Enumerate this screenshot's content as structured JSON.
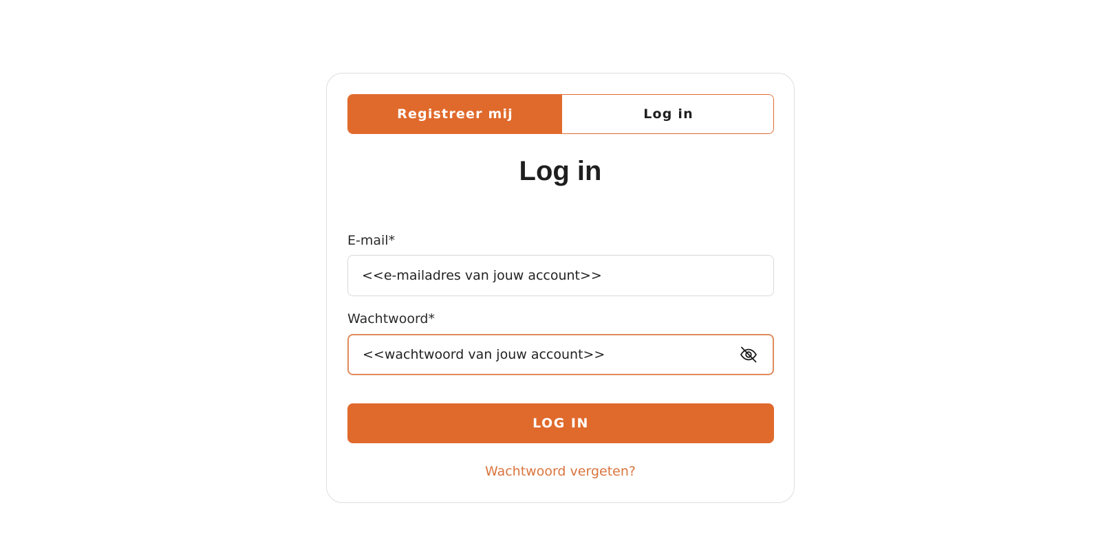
{
  "tabs": {
    "register_label": "Registreer mij",
    "login_label": "Log in",
    "active": "register"
  },
  "form": {
    "title": "Log in",
    "email_label": "E-mail*",
    "email_value": "<<e-mailadres van jouw account>>",
    "password_label": "Wachtwoord*",
    "password_value": "<<wachtwoord van jouw account>>",
    "password_toggle_icon": "eye-off-icon",
    "submit_label": "LOG IN",
    "forgot_link": "Wachtwoord vergeten?"
  },
  "colors": {
    "accent": "#e06a2c",
    "link": "#d9743d",
    "focus_border": "#e08a5a"
  }
}
